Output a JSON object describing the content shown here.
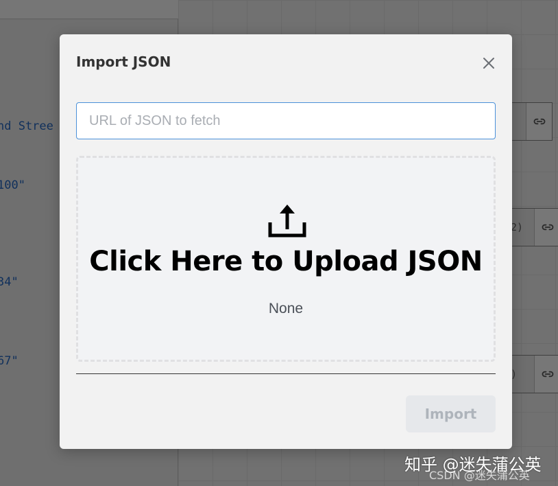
{
  "background": {
    "code_lines": [
      "nd Stree",
      "100\"",
      "34\"",
      "67\""
    ],
    "nodes": [
      {
        "text": ""
      },
      {
        "text": "2)"
      },
      {
        "text": ")"
      }
    ],
    "link_icon": "link-icon"
  },
  "modal": {
    "title": "Import JSON",
    "close_icon": "close-icon",
    "url_input": {
      "value": "",
      "placeholder": "URL of JSON to fetch"
    },
    "dropzone": {
      "icon": "upload-icon",
      "title": "Click Here to Upload JSON",
      "status": "None"
    },
    "import_label": "Import"
  },
  "watermarks": {
    "zhihu": "知乎 @迷失蒲公英",
    "csdn": "CSDN @迷失蒲公英"
  },
  "colors": {
    "overlay_background": "#717171",
    "modal_background": "#f2f2f2",
    "input_border": "#4a90d9",
    "disabled_button_bg": "#e6e8eb",
    "disabled_button_text": "#aeb4bb",
    "code_text": "#10305c"
  }
}
